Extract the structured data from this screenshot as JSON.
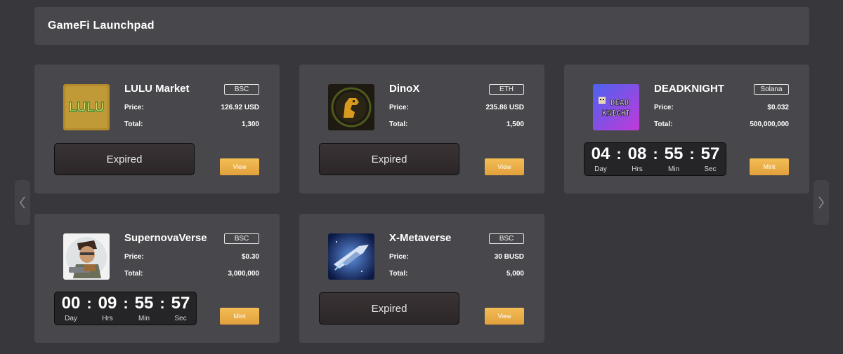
{
  "header": {
    "title": "GameFi Launchpad"
  },
  "labels": {
    "price": "Price:",
    "total": "Total:"
  },
  "timer_labels": {
    "day": "Day",
    "hrs": "Hrs",
    "min": "Min",
    "sec": "Sec"
  },
  "cards": [
    {
      "name": "LULU Market",
      "chain": "BSC",
      "price": "126.92 USD",
      "total": "1,300",
      "status": "Expired",
      "button": "View",
      "logo_icon": "lulu-market-logo",
      "logo_text": "LULU"
    },
    {
      "name": "DinoX",
      "chain": "ETH",
      "price": "235.86 USD",
      "total": "1,500",
      "status": "Expired",
      "button": "View",
      "logo_icon": "dinox-logo"
    },
    {
      "name": "DEADKNIGHT",
      "chain": "Solana",
      "price": "$0.032",
      "total": "500,000,000",
      "countdown": {
        "day": "04",
        "hrs": "08",
        "min": "55",
        "sec": "57"
      },
      "button": "Mint",
      "logo_icon": "deadknight-logo",
      "logo_text": [
        "DEAD",
        "KNIGHT"
      ]
    },
    {
      "name": "SupernovaVerse",
      "chain": "BSC",
      "price": "$0.30",
      "total": "3,000,000",
      "countdown": {
        "day": "00",
        "hrs": "09",
        "min": "55",
        "sec": "57"
      },
      "button": "Mint",
      "logo_icon": "supernovaverse-logo"
    },
    {
      "name": "X-Metaverse",
      "chain": "BSC",
      "price": "30 BUSD",
      "total": "5,000",
      "status": "Expired",
      "button": "View",
      "logo_icon": "x-metaverse-logo"
    }
  ],
  "colors": {
    "background": "#38373b",
    "panel": "#48474b",
    "button": "#f0b44d",
    "timer_bg": "#252426"
  }
}
